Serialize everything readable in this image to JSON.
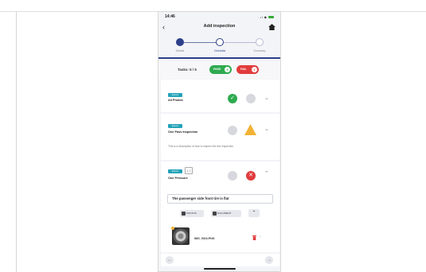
{
  "status": {
    "time": "14:46",
    "signal": "..ıl ◆"
  },
  "nav": {
    "back_icon": "‹",
    "title": "Add inspection"
  },
  "stepper": {
    "steps": [
      "Details",
      "Checklist",
      "Summary"
    ],
    "active_index": 1
  },
  "tasks": {
    "label": "Tasks: 5 / 5",
    "pass_label": "PASS",
    "pass_count": "3",
    "fail_label": "FAIL",
    "fail_count": "1"
  },
  "items": [
    {
      "tag": "Exterior",
      "title": "All Photos",
      "status": "pass"
    },
    {
      "tag": "Exterior",
      "title": "One Pass Inspection",
      "description": "This is a description of how to inspect the line inspection.",
      "status": "warning"
    },
    {
      "tag": "Exterior",
      "badge": "1 ⓘ",
      "title": "One Pressure",
      "status": "fail"
    }
  ],
  "comment": {
    "value": "The passenger side front tire is flat"
  },
  "actions": {
    "photo_label": "PHOTOS",
    "document_label": "DOCUMENT"
  },
  "attachment": {
    "filename": "IMG_0016.PNG"
  },
  "colors": {
    "pass": "#2eaa4f",
    "fail": "#e13c3c",
    "warning": "#f2b233",
    "accent": "#2d3f8a",
    "tag": "#23a3b8"
  }
}
